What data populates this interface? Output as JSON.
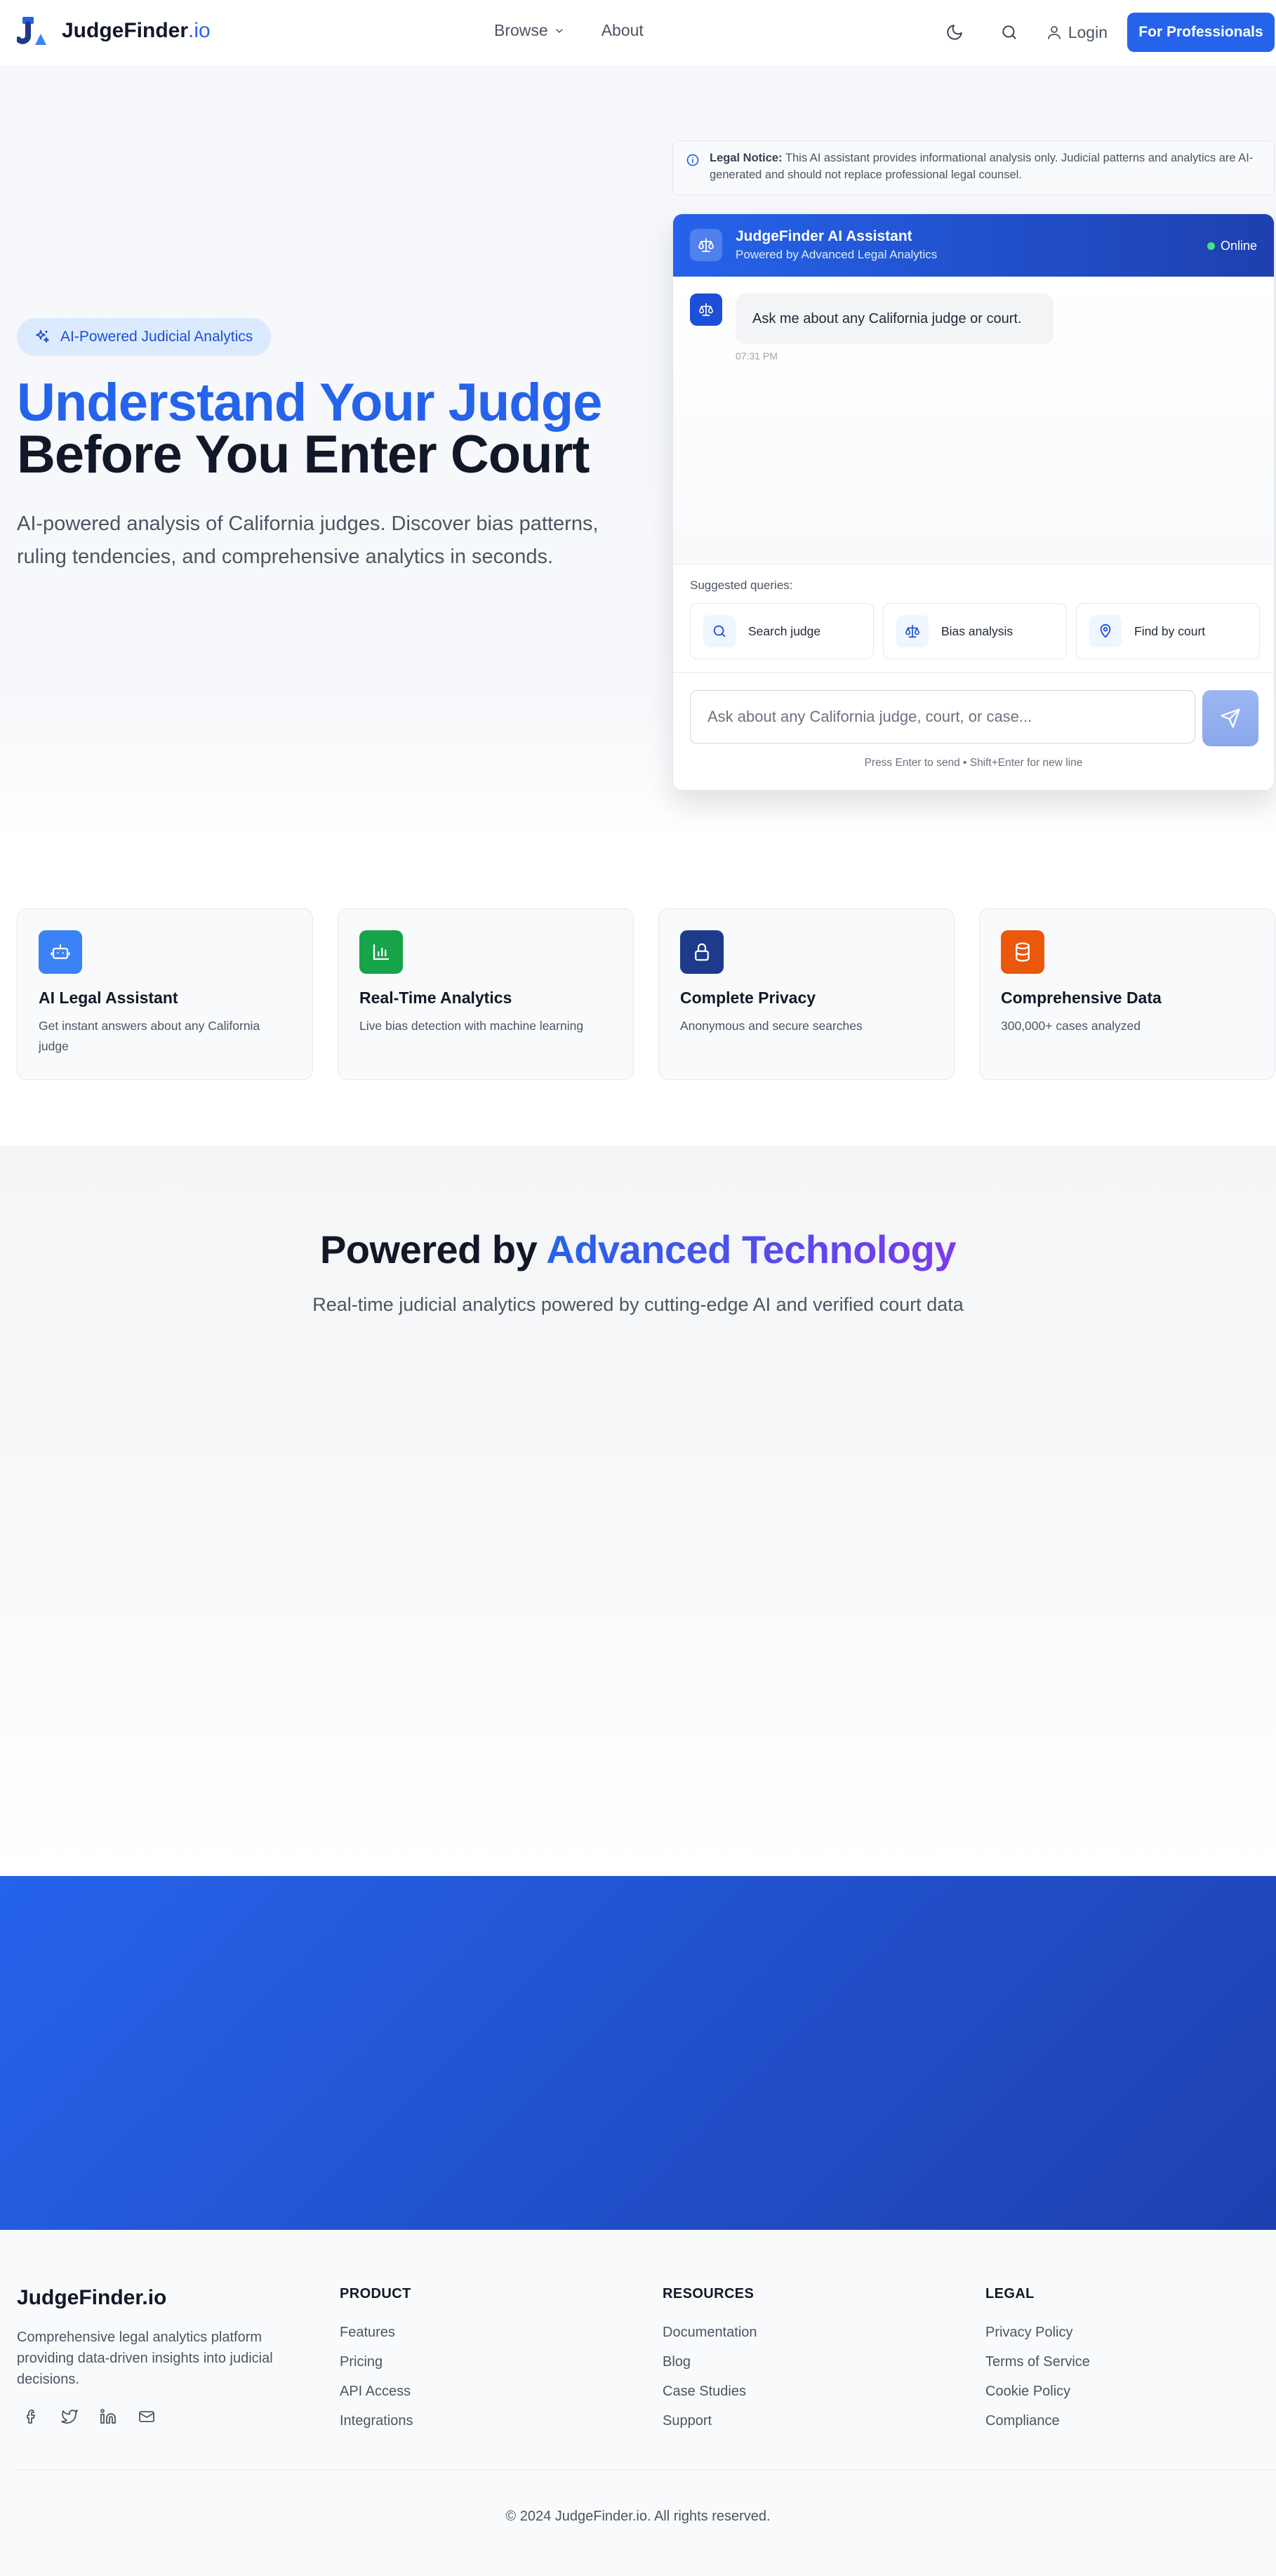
{
  "nav": {
    "brand_main": "JudgeFinder",
    "brand_tld": ".io",
    "browse": "Browse",
    "about": "About",
    "login": "Login",
    "pro_button": "For Professionals"
  },
  "hero": {
    "badge": "AI-Powered Judicial Analytics",
    "headline_line1": "Understand Your Judge",
    "headline_line2": "Before You Enter Court",
    "subtitle": "AI-powered analysis of California judges. Discover bias patterns, ruling tendencies, and comprehensive analytics in seconds."
  },
  "notice": {
    "label": "Legal Notice:",
    "text": " This AI assistant provides informational analysis only. Judicial patterns and analytics are AI-generated and should not replace professional legal counsel."
  },
  "chat": {
    "title": "JudgeFinder AI Assistant",
    "subtitle": "Powered by Advanced Legal Analytics",
    "status": "Online",
    "message": "Ask me about any California judge or court.",
    "message_time": "07:31 PM",
    "suggested_label": "Suggested queries:",
    "suggestions": [
      "Search judge",
      "Bias analysis",
      "Find by court"
    ],
    "input_placeholder": "Ask about any California judge, court, or case...",
    "hint": "Press Enter to send • Shift+Enter for new line"
  },
  "features": [
    {
      "title": "AI Legal Assistant",
      "desc": "Get instant answers about any California judge",
      "color": "#3b82f6"
    },
    {
      "title": "Real-Time Analytics",
      "desc": "Live bias detection with machine learning",
      "color": "#16a34a"
    },
    {
      "title": "Complete Privacy",
      "desc": "Anonymous and secure searches",
      "color": "#1e3a8a"
    },
    {
      "title": "Comprehensive Data",
      "desc": "300,000+ cases analyzed",
      "color": "#ea580c"
    }
  ],
  "tech": {
    "title_plain": "Powered by ",
    "title_accent": "Advanced Technology",
    "subtitle": "Real-time judicial analytics powered by cutting-edge AI and verified court data"
  },
  "footer": {
    "brand": "JudgeFinder.io",
    "about": "Comprehensive legal analytics platform providing data-driven insights into judicial decisions.",
    "columns": [
      {
        "heading": "PRODUCT",
        "links": [
          "Features",
          "Pricing",
          "API Access",
          "Integrations"
        ]
      },
      {
        "heading": "RESOURCES",
        "links": [
          "Documentation",
          "Blog",
          "Case Studies",
          "Support"
        ]
      },
      {
        "heading": "LEGAL",
        "links": [
          "Privacy Policy",
          "Terms of Service",
          "Cookie Policy",
          "Compliance"
        ]
      }
    ],
    "copyright": "© 2024 JudgeFinder.io. All rights reserved."
  }
}
